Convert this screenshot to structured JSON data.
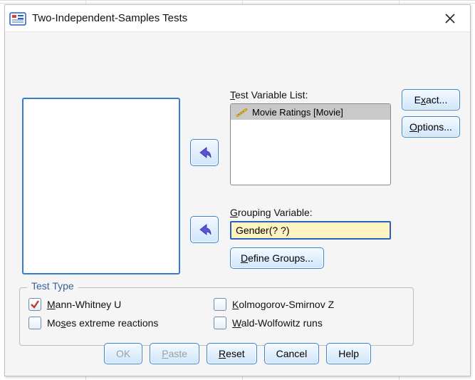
{
  "window": {
    "title": "Two-Independent-Samples Tests"
  },
  "labels": {
    "test_variable_list": "Test Variable List:",
    "grouping_variable": "Grouping Variable:"
  },
  "test_variable_items": [
    {
      "label": "Movie Ratings [Movie]"
    }
  ],
  "grouping_value": "Gender(? ?)",
  "buttons": {
    "define_groups": "Define Groups...",
    "exact": "Exact...",
    "options": "Options...",
    "ok": "OK",
    "paste": "Paste",
    "reset": "Reset",
    "cancel": "Cancel",
    "help": "Help"
  },
  "test_type": {
    "legend": "Test Type",
    "mann_whitney": "Mann-Whitney U",
    "kolmogorov": "Kolmogorov-Smirnov Z",
    "moses": "Moses extreme reactions",
    "wald": "Wald-Wolfowitz runs"
  },
  "checks": {
    "mann_whitney": true,
    "kolmogorov": false,
    "moses": false,
    "wald": false
  }
}
